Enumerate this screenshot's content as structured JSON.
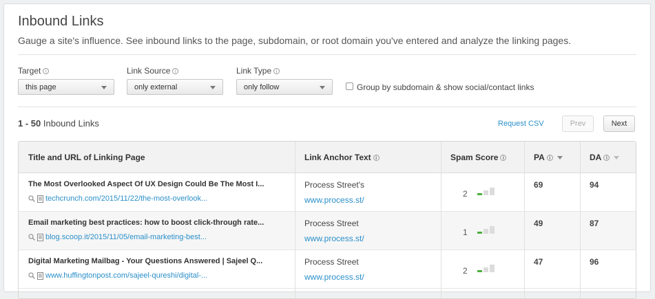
{
  "header": {
    "title": "Inbound Links",
    "subtitle": "Gauge a site's influence. See inbound links to the page, subdomain, or root domain you've entered and analyze the linking pages."
  },
  "filters": {
    "target": {
      "label": "Target",
      "value": "this page"
    },
    "link_source": {
      "label": "Link Source",
      "value": "only external"
    },
    "link_type": {
      "label": "Link Type",
      "value": "only follow"
    },
    "group_checkbox": {
      "label": "Group by subdomain & show social/contact links",
      "checked": false
    }
  },
  "results": {
    "range": "1 - 50",
    "label": "Inbound Links",
    "request_csv": "Request CSV",
    "prev": "Prev",
    "next": "Next"
  },
  "table": {
    "columns": {
      "title_url": "Title and URL of Linking Page",
      "anchor": "Link Anchor Text",
      "spam": "Spam Score",
      "pa": "PA",
      "da": "DA"
    },
    "rows": [
      {
        "title": "The Most Overlooked Aspect Of UX Design Could Be The Most I...",
        "url": "techcrunch.com/2015/11/22/the-most-overlook...",
        "anchor_text": "Process Street's",
        "anchor_url": "www.process.st/",
        "spam_score": "2",
        "pa": "69",
        "da": "94"
      },
      {
        "title": "Email marketing best practices: how to boost click-through rate...",
        "url": "blog.scoop.it/2015/11/05/email-marketing-best...",
        "anchor_text": "Process Street",
        "anchor_url": "www.process.st/",
        "spam_score": "1",
        "pa": "49",
        "da": "87"
      },
      {
        "title": "Digital Marketing Mailbag - Your Questions Answered | Sajeel Q...",
        "url": "www.huffingtonpost.com/sajeel-qureshi/digital-...",
        "anchor_text": "Process Street",
        "anchor_url": "www.process.st/",
        "spam_score": "2",
        "pa": "47",
        "da": "96"
      }
    ]
  },
  "colors": {
    "link": "#2a8fc9",
    "spam_low": "#4caf3d",
    "spam_bar_empty": "#dcdcdc"
  }
}
